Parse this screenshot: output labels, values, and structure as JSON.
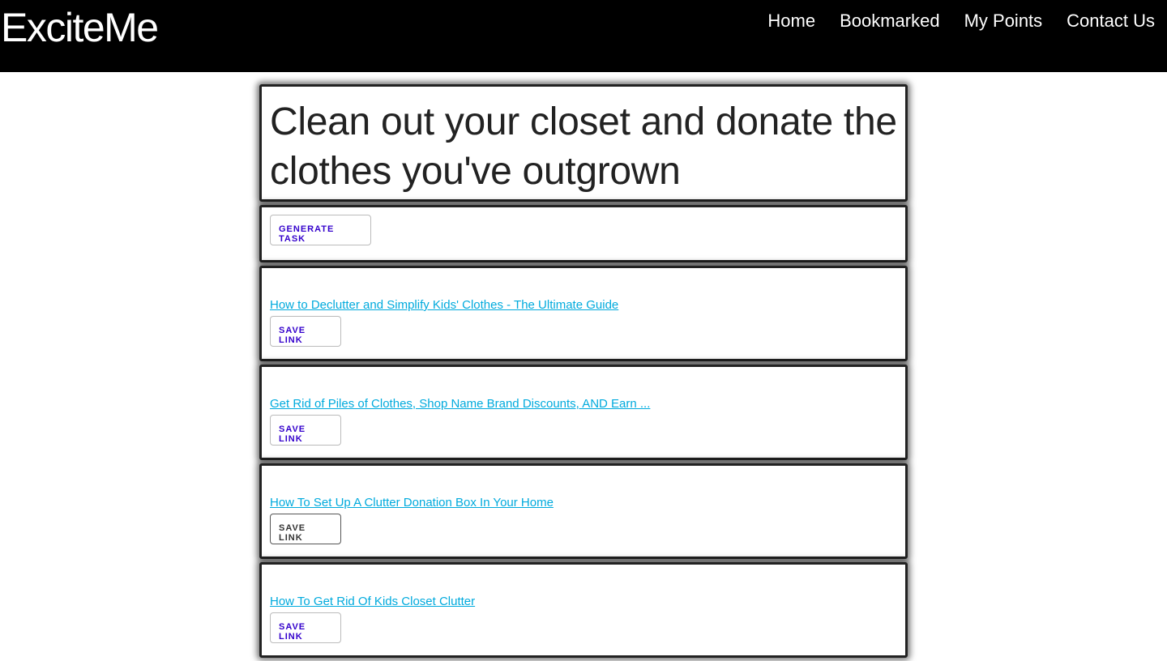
{
  "navbar": {
    "brand": "ExciteMe",
    "links": [
      "Home",
      "Bookmarked",
      "My Points",
      "Contact Us"
    ]
  },
  "task": {
    "title": "Clean out your closet and donate the clothes you've outgrown",
    "generate_label": "GENERATE TASK"
  },
  "results": [
    {
      "title": "How to Declutter and Simplify Kids' Clothes - The Ultimate Guide",
      "save_label": "SAVE LINK"
    },
    {
      "title": "Get Rid of Piles of Clothes, Shop Name Brand Discounts, AND Earn ...",
      "save_label": "SAVE LINK"
    },
    {
      "title": "How To Set Up A Clutter Donation Box In Your Home",
      "save_label": "SAVE LINK"
    },
    {
      "title": "How To Get Rid Of Kids Closet Clutter",
      "save_label": "SAVE LINK"
    }
  ],
  "colors": {
    "navbar_bg": "#000000",
    "link": "#00aadd",
    "button_text": "#3300cc",
    "card_border": "#222222"
  }
}
